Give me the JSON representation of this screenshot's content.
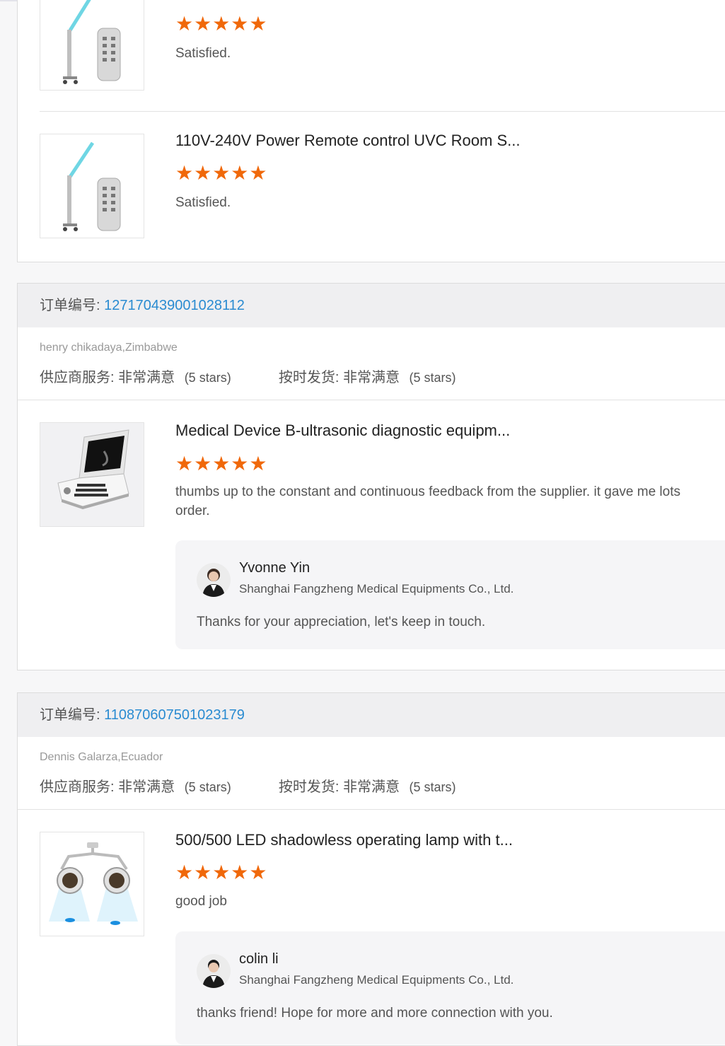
{
  "colors": {
    "accent": "#2a8bd1",
    "star": "#f0680a"
  },
  "card1": {
    "items": [
      {
        "title": "",
        "stars": "★★★★★",
        "comment": "Satisfied."
      },
      {
        "title": "110V-240V Power Remote control UVC Room S...",
        "stars": "★★★★★",
        "comment": "Satisfied."
      }
    ]
  },
  "card2": {
    "order_label": "订单编号:",
    "order_number": "127170439001028112",
    "buyer": "henry chikadaya,Zimbabwe",
    "supplier_service_label": "供应商服务: 非常满意",
    "supplier_service_stars": "(5 stars)",
    "on_time_label": "按时发货: 非常满意",
    "on_time_stars": "(5 stars)",
    "item": {
      "title": "Medical Device B-ultrasonic diagnostic equipm...",
      "stars": "★★★★★",
      "comment_line1": "thumbs up to the constant and continuous feedback from the supplier. it gave me lots",
      "comment_line2": "order."
    },
    "reply": {
      "name": "Yvonne Yin",
      "company": "Shanghai Fangzheng Medical Equipments Co., Ltd.",
      "text": "Thanks for your appreciation, let's keep in touch."
    }
  },
  "card3": {
    "order_label": "订单编号:",
    "order_number": "110870607501023179",
    "buyer": "Dennis Galarza,Ecuador",
    "supplier_service_label": "供应商服务: 非常满意",
    "supplier_service_stars": "(5 stars)",
    "on_time_label": "按时发货: 非常满意",
    "on_time_stars": "(5 stars)",
    "item": {
      "title": "500/500 LED shadowless operating lamp with t...",
      "stars": "★★★★★",
      "comment": "good job"
    },
    "reply": {
      "name": "colin li",
      "company": "Shanghai Fangzheng Medical Equipments Co., Ltd.",
      "text": "thanks friend! Hope for more and more connection with you."
    }
  }
}
